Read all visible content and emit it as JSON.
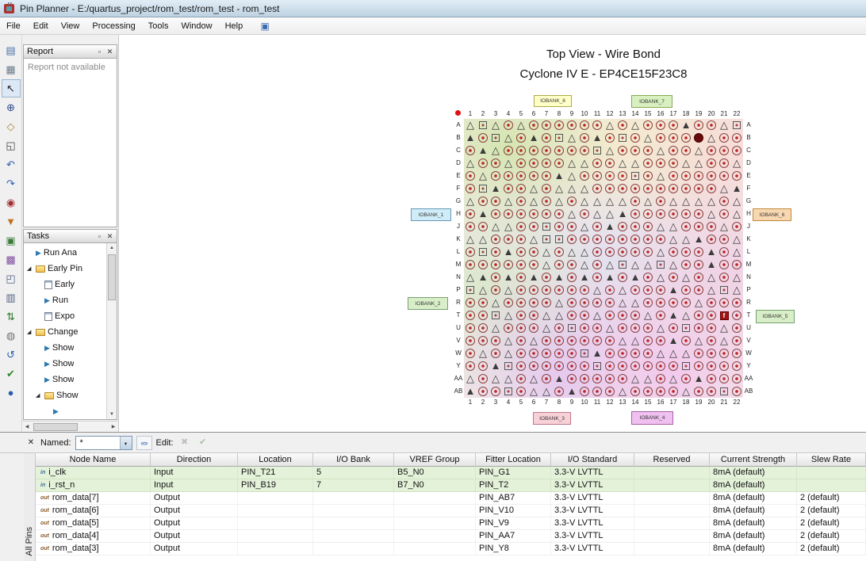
{
  "window": {
    "title": "Pin Planner - E:/quartus_project/rom_test/rom_test - rom_test"
  },
  "menu": {
    "items": [
      "File",
      "Edit",
      "View",
      "Processing",
      "Tools",
      "Window",
      "Help"
    ]
  },
  "left_toolbar": {
    "icons": [
      {
        "name": "dock-window-icon",
        "glyph": "▤",
        "color": "#4a6fa5"
      },
      {
        "name": "package-view-icon",
        "glyph": "▦",
        "color": "#6a7a8a"
      },
      {
        "name": "pointer-tool-icon",
        "glyph": "↖",
        "color": "#222222",
        "active": true
      },
      {
        "name": "zoom-tool-icon",
        "glyph": "⊕",
        "color": "#2a4a8a"
      },
      {
        "name": "hand-tool-icon",
        "glyph": "◇",
        "color": "#b08030"
      },
      {
        "name": "fit-view-icon",
        "glyph": "◱",
        "color": "#444444"
      },
      {
        "name": "undo-icon",
        "glyph": "↶",
        "color": "#2a5db0"
      },
      {
        "name": "redo-icon",
        "glyph": "↷",
        "color": "#2a5db0"
      },
      {
        "name": "pin-color-icon",
        "glyph": "◉",
        "color": "#a03030"
      },
      {
        "name": "highlight-pins-icon",
        "glyph": "▼",
        "color": "#c07020"
      },
      {
        "name": "show-node-names-icon",
        "glyph": "▣",
        "color": "#3a7a3a"
      },
      {
        "name": "show-io-banks-icon",
        "glyph": "▩",
        "color": "#8050a0"
      },
      {
        "name": "pad-view-icon",
        "glyph": "◰",
        "color": "#506080"
      },
      {
        "name": "report-view-icon",
        "glyph": "▥",
        "color": "#506080"
      },
      {
        "name": "pin-migration-icon",
        "glyph": "⇅",
        "color": "#2a7a2a"
      },
      {
        "name": "bga-view-icon",
        "glyph": "◍",
        "color": "#707070"
      },
      {
        "name": "refresh-icon",
        "glyph": "↺",
        "color": "#2a5db0"
      },
      {
        "name": "check-legality-icon",
        "glyph": "✔",
        "color": "#2a8a2a"
      },
      {
        "name": "pin-tool-icon",
        "glyph": "●",
        "color": "#2a5db0"
      }
    ]
  },
  "report_panel": {
    "title": "Report",
    "message": "Report not available"
  },
  "tasks_panel": {
    "title": "Tasks",
    "items": [
      {
        "indent": 1,
        "icon": "play",
        "label": "Run Ana"
      },
      {
        "indent": 0,
        "icon": "folder",
        "label": "Early Pin",
        "expanded": true
      },
      {
        "indent": 2,
        "icon": "page",
        "label": "Early"
      },
      {
        "indent": 2,
        "icon": "play",
        "label": "Run"
      },
      {
        "indent": 2,
        "icon": "page",
        "label": "Expo"
      },
      {
        "indent": 0,
        "icon": "folder",
        "label": "Change",
        "expanded": true
      },
      {
        "indent": 2,
        "icon": "play",
        "label": "Show"
      },
      {
        "indent": 2,
        "icon": "play",
        "label": "Show"
      },
      {
        "indent": 2,
        "icon": "play",
        "label": "Show"
      },
      {
        "indent": 1,
        "icon": "folder",
        "label": "Show",
        "expanded": true
      },
      {
        "indent": 3,
        "icon": "play",
        "label": ""
      }
    ]
  },
  "package_view": {
    "title_line1": "Top View - Wire Bond",
    "title_line2": "Cyclone IV E - EP4CE15F23C8",
    "columns": [
      "1",
      "2",
      "3",
      "4",
      "5",
      "6",
      "7",
      "8",
      "9",
      "10",
      "11",
      "12",
      "13",
      "14",
      "15",
      "16",
      "17",
      "18",
      "19",
      "20",
      "21",
      "22"
    ],
    "rows": [
      "A",
      "B",
      "C",
      "D",
      "E",
      "F",
      "G",
      "H",
      "J",
      "K",
      "L",
      "M",
      "N",
      "P",
      "R",
      "T",
      "U",
      "V",
      "W",
      "Y",
      "AA",
      "AB"
    ],
    "bank_labels": [
      {
        "pos": "tl",
        "label": "IOBANK_8",
        "bg": "#ffffc8",
        "border": "#b0a850"
      },
      {
        "pos": "tr",
        "label": "IOBANK_7",
        "bg": "#d8f0c0",
        "border": "#88a858"
      },
      {
        "pos": "lt",
        "label": "IOBANK_1",
        "bg": "#d0ecf8",
        "border": "#6898b8"
      },
      {
        "pos": "lb",
        "label": "IOBANK_2",
        "bg": "#d8eec8",
        "border": "#78a070"
      },
      {
        "pos": "rt",
        "label": "IOBANK_6",
        "bg": "#f8d8b0",
        "border": "#c08840"
      },
      {
        "pos": "rb",
        "label": "IOBANK_5",
        "bg": "#d8eec8",
        "border": "#78a070"
      },
      {
        "pos": "bl",
        "label": "IOBANK_3",
        "bg": "#f8d0d8",
        "border": "#c07888"
      },
      {
        "pos": "br",
        "label": "IOBANK_4",
        "bg": "#f0c0f0",
        "border": "#a860a8"
      }
    ],
    "assigned_pins": [
      {
        "row": "B",
        "col": 19,
        "shape": "filled-circle"
      },
      {
        "row": "T",
        "col": 21,
        "shape": "filled-square",
        "glyph": "f"
      }
    ]
  },
  "bottom_toolbar": {
    "named_label": "Named:",
    "named_value": "*",
    "edit_label": "Edit:"
  },
  "side_tab": {
    "label": "All Pins"
  },
  "pin_table": {
    "headers": [
      "Node Name",
      "Direction",
      "Location",
      "I/O Bank",
      "VREF Group",
      "Fitter Location",
      "I/O Standard",
      "Reserved",
      "Current Strength",
      "Slew Rate"
    ],
    "rows": [
      {
        "icon": "in",
        "name": "i_clk",
        "direction": "Input",
        "location": "PIN_T21",
        "io_bank": "5",
        "vref_group": "B5_N0",
        "fitter_location": "PIN_G1",
        "io_standard": "3.3-V LVTTL",
        "reserved": "",
        "current_strength": "8mA (default)",
        "slew_rate": "",
        "assigned": true
      },
      {
        "icon": "in",
        "name": "i_rst_n",
        "direction": "Input",
        "location": "PIN_B19",
        "io_bank": "7",
        "vref_group": "B7_N0",
        "fitter_location": "PIN_T2",
        "io_standard": "3.3-V LVTTL",
        "reserved": "",
        "current_strength": "8mA (default)",
        "slew_rate": "",
        "assigned": true
      },
      {
        "icon": "out",
        "name": "rom_data[7]",
        "direction": "Output",
        "location": "",
        "io_bank": "",
        "vref_group": "",
        "fitter_location": "PIN_AB7",
        "io_standard": "3.3-V LVTTL",
        "reserved": "",
        "current_strength": "8mA (default)",
        "slew_rate": "2 (default)"
      },
      {
        "icon": "out",
        "name": "rom_data[6]",
        "direction": "Output",
        "location": "",
        "io_bank": "",
        "vref_group": "",
        "fitter_location": "PIN_V10",
        "io_standard": "3.3-V LVTTL",
        "reserved": "",
        "current_strength": "8mA (default)",
        "slew_rate": "2 (default)"
      },
      {
        "icon": "out",
        "name": "rom_data[5]",
        "direction": "Output",
        "location": "",
        "io_bank": "",
        "vref_group": "",
        "fitter_location": "PIN_V9",
        "io_standard": "3.3-V LVTTL",
        "reserved": "",
        "current_strength": "8mA (default)",
        "slew_rate": "2 (default)"
      },
      {
        "icon": "out",
        "name": "rom_data[4]",
        "direction": "Output",
        "location": "",
        "io_bank": "",
        "vref_group": "",
        "fitter_location": "PIN_AA7",
        "io_standard": "3.3-V LVTTL",
        "reserved": "",
        "current_strength": "8mA (default)",
        "slew_rate": "2 (default)"
      },
      {
        "icon": "out",
        "name": "rom_data[3]",
        "direction": "Output",
        "location": "",
        "io_bank": "",
        "vref_group": "",
        "fitter_location": "PIN_Y8",
        "io_standard": "3.3-V LVTTL",
        "reserved": "",
        "current_strength": "8mA (default)",
        "slew_rate": "2 (default)"
      }
    ]
  }
}
